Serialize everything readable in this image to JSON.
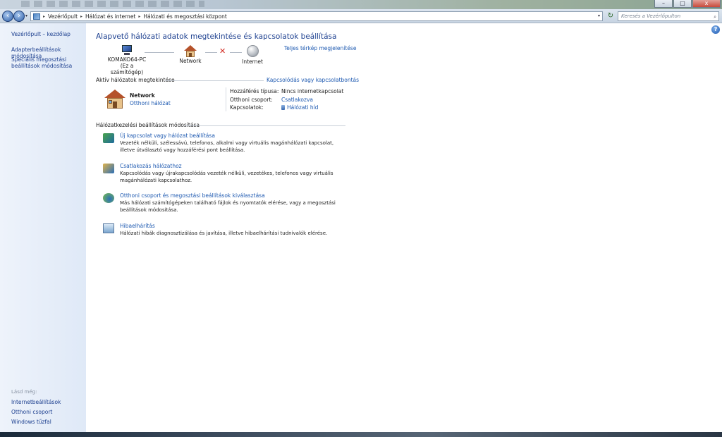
{
  "window": {
    "minimize": "–",
    "maximize": "□",
    "close": "x"
  },
  "address": {
    "crumbs": [
      "Vezérlőpult",
      "Hálózat és internet",
      "Hálózati és megosztási központ"
    ],
    "search_placeholder": "Keresés a Vezérlőpulton"
  },
  "sidebar": {
    "home": "Vezérlőpult – kezdőlap",
    "adapter": "Adapterbeállítások módosítása",
    "sharing": "Speciális megosztási beállítások módosítása",
    "see_also": "Lásd még:",
    "internet_options": "Internetbeállítások",
    "homegroup": "Otthoni csoport",
    "firewall": "Windows tűzfal"
  },
  "main": {
    "title": "Alapvető hálózati adatok megtekintése és kapcsolatok beállítása",
    "full_map": "Teljes térkép megjelenítése",
    "map": {
      "pc_name": "KOMAKO64-PC",
      "pc_sub": "(Ez a számítógép)",
      "network": "Network",
      "internet": "Internet"
    },
    "active_heading": "Aktív hálózatok megtekintése",
    "connect_link": "Kapcsolódás vagy kapcsolatbontás",
    "active": {
      "name": "Network",
      "type": "Otthoni hálózat",
      "access_label": "Hozzáférés típusa:",
      "access_value": "Nincs internetkapcsolat",
      "homegroup_label": "Otthoni csoport:",
      "homegroup_value": "Csatlakozva",
      "connections_label": "Kapcsolatok:",
      "connections_value": "Hálózati híd"
    },
    "settings_heading": "Hálózatkezelési beállítások módosítása",
    "tasks": [
      {
        "icon": "new-connection-icon",
        "title": "Új kapcsolat vagy hálózat beállítása",
        "desc": "Vezeték nélküli, szélessávú, telefonos, alkalmi vagy virtuális magánhálózati kapcsolat, illetve útválasztó vagy hozzáférési pont beállítása."
      },
      {
        "icon": "connect-network-icon",
        "title": "Csatlakozás hálózathoz",
        "desc": "Kapcsolódás vagy újrakapcsolódás vezeték nélküli, vezetékes, telefonos vagy virtuális magánhálózati kapcsolathoz."
      },
      {
        "icon": "homegroup-icon",
        "title": "Otthoni csoport és megosztási beállítások kiválasztása",
        "desc": "Más hálózati számítógépeken található fájlok és nyomtatók elérése, vagy a megosztási beállítások módosítása."
      },
      {
        "icon": "troubleshoot-icon",
        "title": "Hibaelhárítás",
        "desc": "Hálózati hibák diagnosztizálása és javítása, illetve hibaelhárítási tudnivalók elérése."
      }
    ]
  }
}
